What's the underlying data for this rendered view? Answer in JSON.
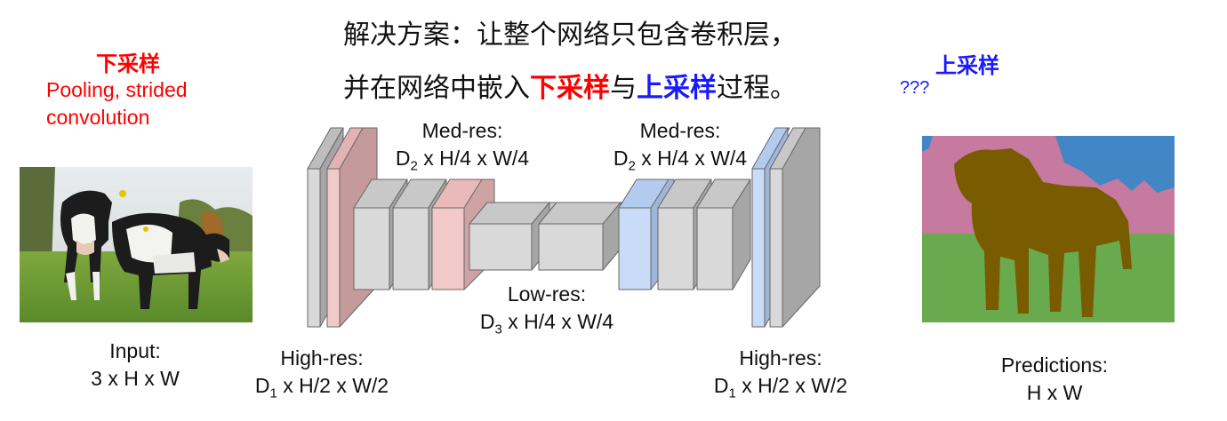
{
  "title": {
    "line1": "解决方案：让整个网络只包含卷积层，",
    "line2_pre": "并在网络中嵌入",
    "line2_down": "下采样",
    "line2_mid": "与",
    "line2_up": "上采样",
    "line2_post": "过程。"
  },
  "left_note": {
    "heading": "下采样",
    "line1": "Pooling, strided",
    "line2": "convolution"
  },
  "right_note": {
    "heading": "上采样",
    "line1": "???"
  },
  "labels": {
    "input": {
      "line1": "Input:",
      "line2": "3 x H x W"
    },
    "high_res_left": {
      "line1": "High-res:",
      "d": "D",
      "sub": "1",
      "rest": " x H/2 x W/2"
    },
    "med_res_left": {
      "line1": "Med-res:",
      "d": "D",
      "sub": "2",
      "rest": " x H/4 x W/4"
    },
    "low_res": {
      "line1": "Low-res:",
      "d": "D",
      "sub": "3",
      "rest": " x H/4 x W/4"
    },
    "med_res_right": {
      "line1": "Med-res:",
      "d": "D",
      "sub": "2",
      "rest": " x H/4 x W/4"
    },
    "high_res_right": {
      "line1": "High-res:",
      "d": "D",
      "sub": "1",
      "rest": " x H/2 x W/2"
    },
    "predictions": {
      "line1": "Predictions:",
      "line2": "H x W"
    }
  },
  "colors": {
    "downsample": "#ff0000",
    "upsample": "#1a1aff",
    "block_gray": "#d9d9d9",
    "block_pink": "#f2c9c9",
    "block_blue": "#c9dbf7",
    "seg_cow": "#7a5c00",
    "seg_sky": "#4286c6",
    "seg_tree": "#c67aa0",
    "seg_grass": "#6aaa4e"
  },
  "images": {
    "input_photo": "cows-in-field-photo",
    "prediction": "segmentation-map"
  }
}
